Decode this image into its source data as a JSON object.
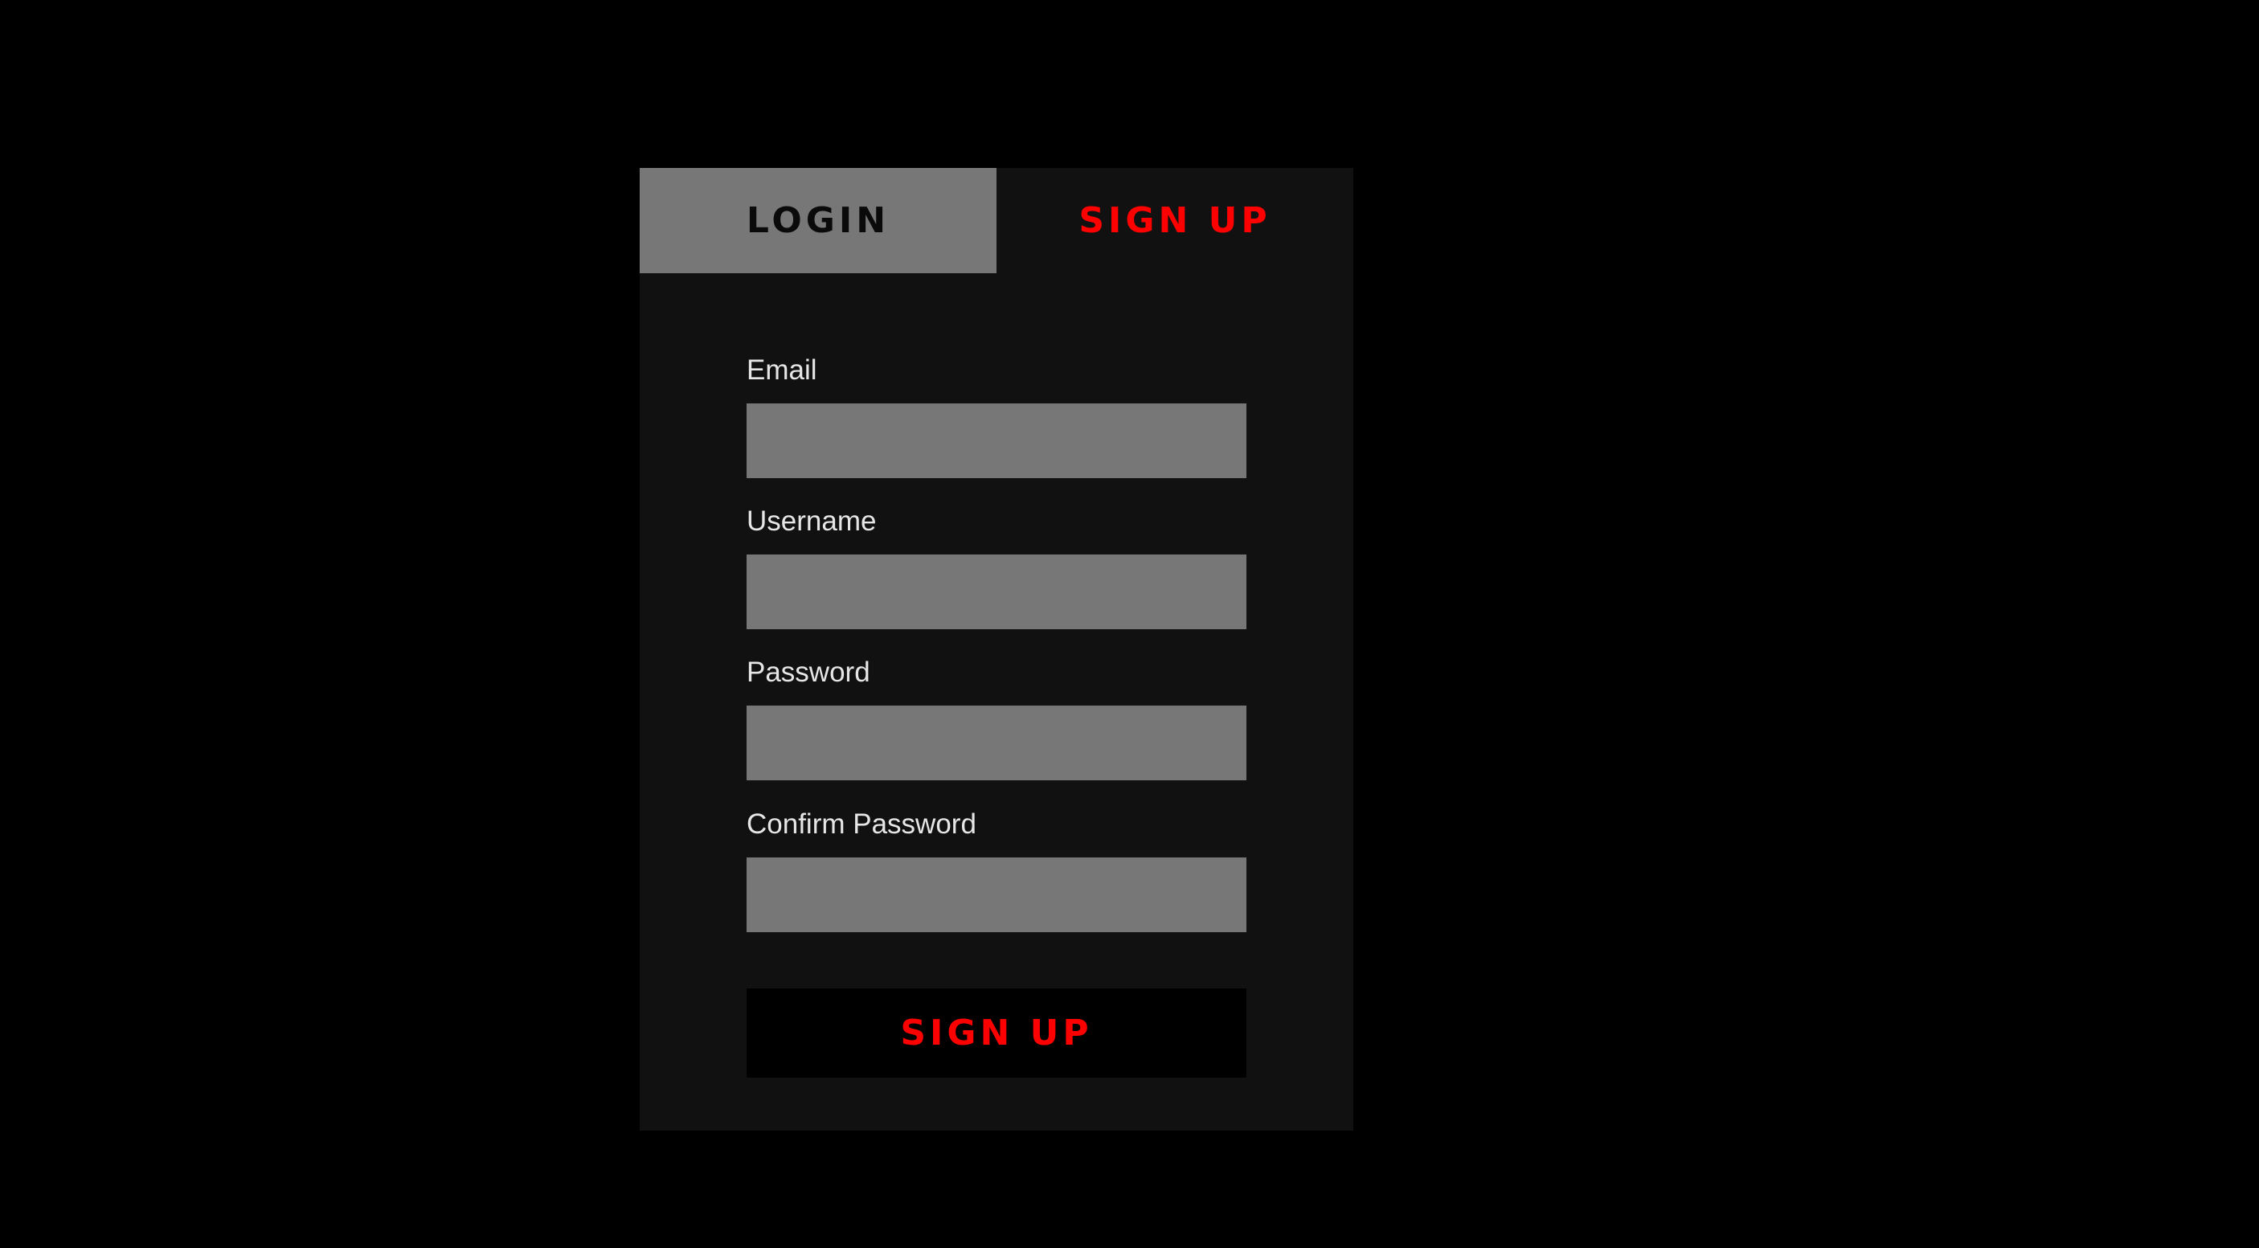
{
  "tabs": {
    "login_label": "LOGIN",
    "signup_label": "SIGN UP",
    "active": "signup"
  },
  "form": {
    "fields": [
      {
        "label": "Email",
        "value": "",
        "placeholder": ""
      },
      {
        "label": "Username",
        "value": "",
        "placeholder": ""
      },
      {
        "label": "Password",
        "value": "",
        "placeholder": ""
      },
      {
        "label": "Confirm Password",
        "value": "",
        "placeholder": ""
      }
    ],
    "submit_label": "SIGN UP"
  },
  "colors": {
    "page_background": "#000000",
    "card_background": "#111111",
    "input_background": "#777777",
    "accent": "#ff0000",
    "label_text": "#e6e6e6"
  }
}
